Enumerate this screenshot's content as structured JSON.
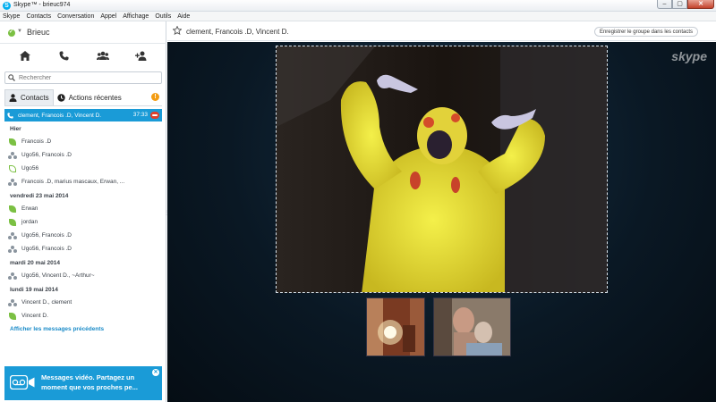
{
  "window": {
    "title": "Skype™ - brieuc974",
    "buttons": [
      "–",
      "▢",
      "✕"
    ]
  },
  "menu": [
    "Skype",
    "Contacts",
    "Conversation",
    "Appel",
    "Affichage",
    "Outils",
    "Aide"
  ],
  "user": {
    "name": "Brieuc"
  },
  "search": {
    "placeholder": "Rechercher"
  },
  "tabs": {
    "contacts": "Contacts",
    "recent": "Actions récentes",
    "alert": "!"
  },
  "active_call": {
    "name": "clement, Francois .D, Vincent D.",
    "duration": "37:33"
  },
  "sections": [
    {
      "label": "Hier",
      "items": [
        {
          "icon": "leaf",
          "label": "Francois .D"
        },
        {
          "icon": "group",
          "label": "Ugo56, Francois .D"
        },
        {
          "icon": "leaf-outline",
          "label": "Ugo56"
        },
        {
          "icon": "group",
          "label": "Francois .D, marius mascaux, Erwan, ..."
        }
      ]
    },
    {
      "label": "vendredi 23 mai 2014",
      "items": [
        {
          "icon": "leaf",
          "label": "Erwan"
        },
        {
          "icon": "leaf",
          "label": "jordan"
        },
        {
          "icon": "group",
          "label": "Ugo56, Francois .D"
        },
        {
          "icon": "group",
          "label": "Ugo56, Francois .D"
        }
      ]
    },
    {
      "label": "mardi 20 mai 2014",
      "items": [
        {
          "icon": "group",
          "label": "Ugo56, Vincent D., ~Arthur~"
        }
      ]
    },
    {
      "label": "lundi 19 mai 2014",
      "items": [
        {
          "icon": "group",
          "label": "Vincent D., clement"
        },
        {
          "icon": "leaf",
          "label": "Vincent D."
        }
      ]
    }
  ],
  "previous_link": "Afficher les messages précédents",
  "promo": {
    "text": "Messages vidéo. Partagez un moment que vos proches pe..."
  },
  "conversation": {
    "title": "clement, Francois .D, Vincent D.",
    "save_button": "Enregistrer le groupe dans les contacts"
  },
  "watermark": "skype",
  "colors": {
    "accent": "#1a9bd7",
    "online": "#7bc043",
    "hangup": "#e0402b",
    "call_bg": "#0a1824"
  }
}
